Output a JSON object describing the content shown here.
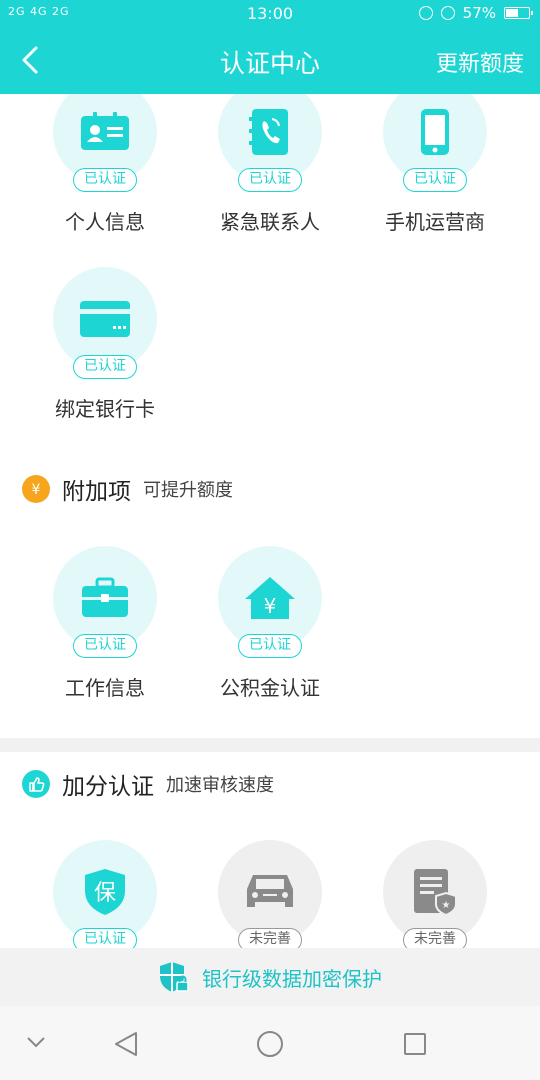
{
  "status_bar": {
    "network": "2G 4G 2G",
    "time": "13:00",
    "battery_percent": "57%",
    "battery_level": 0.57
  },
  "nav": {
    "title": "认证中心",
    "action": "更新额度"
  },
  "basic_items": [
    {
      "label": "个人信息",
      "badge": "已认证",
      "icon": "id-card-icon"
    },
    {
      "label": "紧急联系人",
      "badge": "已认证",
      "icon": "contact-book-icon"
    },
    {
      "label": "手机运营商",
      "badge": "已认证",
      "icon": "mobile-phone-icon"
    },
    {
      "label": "绑定银行卡",
      "badge": "已认证",
      "icon": "bank-card-icon"
    }
  ],
  "extra_section": {
    "title": "附加项",
    "subtitle": "可提升额度",
    "icon": "yuan-coin-icon",
    "items": [
      {
        "label": "工作信息",
        "badge": "已认证",
        "icon": "briefcase-icon"
      },
      {
        "label": "公积金认证",
        "badge": "已认证",
        "icon": "house-fund-icon"
      }
    ]
  },
  "bonus_section": {
    "title": "加分认证",
    "subtitle": "加速审核速度",
    "icon": "thumbs-up-icon",
    "items": [
      {
        "badge": "已认证",
        "icon": "insurance-shield-icon",
        "status": "verified"
      },
      {
        "badge": "未完善",
        "icon": "car-icon",
        "status": "incomplete"
      },
      {
        "badge": "未完善",
        "icon": "certificate-icon",
        "status": "incomplete"
      }
    ]
  },
  "secure_bar": {
    "text": "银行级数据加密保护",
    "icon": "shield-lock-icon"
  },
  "colors": {
    "primary": "#1dd6d4",
    "circle_bg": "#e3f9f9",
    "gray_circle": "#efefef",
    "accent_orange": "#f6a51c"
  }
}
